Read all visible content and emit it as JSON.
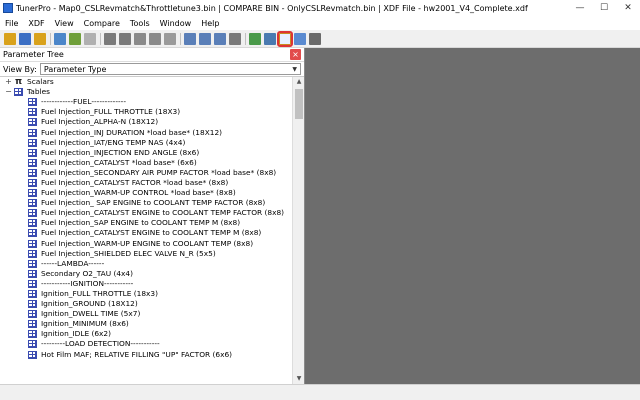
{
  "window": {
    "title": "TunerPro - Map0_CSLRevmatch&Throttletune3.bin | COMPARE BIN - OnlyCSLRevmatch.bin | XDF File - hw2001_V4_Complete.xdf",
    "minimize": "—",
    "maximize": "☐",
    "close": "✕"
  },
  "menu": [
    "File",
    "XDF",
    "View",
    "Compare",
    "Tools",
    "Window",
    "Help"
  ],
  "toolbar": {
    "buttons": [
      {
        "name": "open-icon",
        "color": "#d9a21b"
      },
      {
        "name": "save-icon",
        "color": "#3c6fc4"
      },
      {
        "name": "open-bin-icon",
        "color": "#d9a21b"
      },
      {
        "name": "sep"
      },
      {
        "name": "import-icon",
        "color": "#4b86c9"
      },
      {
        "name": "export-icon",
        "color": "#6f9f3a"
      },
      {
        "name": "new-page-icon",
        "color": "#b0b0b0"
      },
      {
        "name": "sep"
      },
      {
        "name": "delete-icon",
        "color": "#7a7a7a"
      },
      {
        "name": "add-icon",
        "color": "#7a7a7a"
      },
      {
        "name": "copy-icon",
        "color": "#8a8a8a"
      },
      {
        "name": "wrench-icon",
        "color": "#8a8a8a"
      },
      {
        "name": "tool-icon",
        "color": "#9a9a9a"
      },
      {
        "name": "sep"
      },
      {
        "name": "table-view-icon",
        "color": "#5a7fb8"
      },
      {
        "name": "list-view-icon",
        "color": "#5a7fb8"
      },
      {
        "name": "graph-view-icon",
        "color": "#5a7fb8"
      },
      {
        "name": "monitor-icon",
        "color": "#7a7a7a"
      },
      {
        "name": "sep"
      },
      {
        "name": "hex-icon",
        "color": "#4a9a4a"
      },
      {
        "name": "search-icon",
        "color": "#4a7ab0"
      },
      {
        "name": "compare-icon",
        "color": "#c88a20",
        "active": true
      },
      {
        "name": "checksum-icon",
        "color": "#5a8ad0"
      },
      {
        "name": "emulator-icon",
        "color": "#6a6a6a"
      }
    ]
  },
  "panel": {
    "title": "Parameter Tree",
    "close": "×",
    "view_by_label": "View By:",
    "view_by_value": "Parameter Type"
  },
  "tree": [
    {
      "type": "group",
      "icon": "pi",
      "expander": "+",
      "label": "Scalars",
      "indent": 0
    },
    {
      "type": "group",
      "icon": "grid",
      "expander": "−",
      "label": "Tables",
      "indent": 0
    },
    {
      "type": "item",
      "label": "------------FUEL-------------",
      "indent": 2
    },
    {
      "type": "item",
      "label": "Fuel Injection_FULL THROTTLE (18X3)",
      "indent": 2
    },
    {
      "type": "item",
      "label": "Fuel Injection_ALPHA-N (18X12)",
      "indent": 2
    },
    {
      "type": "item",
      "label": "Fuel Injection_INJ DURATION *load base* (18X12)",
      "indent": 2
    },
    {
      "type": "item",
      "label": "Fuel Injection_IAT/ENG TEMP NAS (4x4)",
      "indent": 2
    },
    {
      "type": "item",
      "label": "Fuel Injection_INJECTION END ANGLE (8x6)",
      "indent": 2
    },
    {
      "type": "item",
      "label": "Fuel Injection_CATALYST *load base* (6x6)",
      "indent": 2
    },
    {
      "type": "item",
      "label": "Fuel Injection_SECONDARY AIR PUMP FACTOR *load base* (8x8)",
      "indent": 2
    },
    {
      "type": "item",
      "label": "Fuel Injection_CATALYST FACTOR *load base* (8x8)",
      "indent": 2
    },
    {
      "type": "item",
      "label": "Fuel Injection_WARM-UP CONTROL *load base* (8x8)",
      "indent": 2
    },
    {
      "type": "item",
      "label": "Fuel Injection_ SAP ENGINE to COOLANT TEMP FACTOR (8x8)",
      "indent": 2
    },
    {
      "type": "item",
      "label": "Fuel Injection_CATALYST ENGINE to COOLANT TEMP FACTOR (8x8)",
      "indent": 2
    },
    {
      "type": "item",
      "label": "Fuel Injection_SAP ENGINE to COOLANT TEMP M (8x8)",
      "indent": 2
    },
    {
      "type": "item",
      "label": "Fuel Injection_CATALYST  ENGINE to COOLANT TEMP M (8x8)",
      "indent": 2
    },
    {
      "type": "item",
      "label": "Fuel Injection_WARM-UP ENGINE to COOLANT TEMP (8x8)",
      "indent": 2
    },
    {
      "type": "item",
      "label": "Fuel Injection_SHIELDED ELEC VALVE N_R (5x5)",
      "indent": 2
    },
    {
      "type": "item",
      "label": "------LAMBDA------",
      "indent": 2
    },
    {
      "type": "item",
      "label": "Secondary O2_TAU (4x4)",
      "indent": 2
    },
    {
      "type": "item",
      "label": "-----------IGNITION-----------",
      "indent": 2
    },
    {
      "type": "item",
      "label": "Ignition_FULL THROTTLE (18x3)",
      "indent": 2
    },
    {
      "type": "item",
      "label": "Ignition_GROUND (18X12)",
      "indent": 2
    },
    {
      "type": "item",
      "label": "Ignition_DWELL TIME (5x7)",
      "indent": 2
    },
    {
      "type": "item",
      "label": "Ignition_MINIMUM (8x6)",
      "indent": 2
    },
    {
      "type": "item",
      "label": "Ignition_IDLE (6x2)",
      "indent": 2
    },
    {
      "type": "item",
      "label": "---------LOAD DETECTION-----------",
      "indent": 2
    },
    {
      "type": "item",
      "label": "Hot Film MAF; RELATIVE FILLING \"UP\" FACTOR (6x6)",
      "indent": 2
    }
  ],
  "scroll": {
    "up": "▲",
    "down": "▼"
  }
}
